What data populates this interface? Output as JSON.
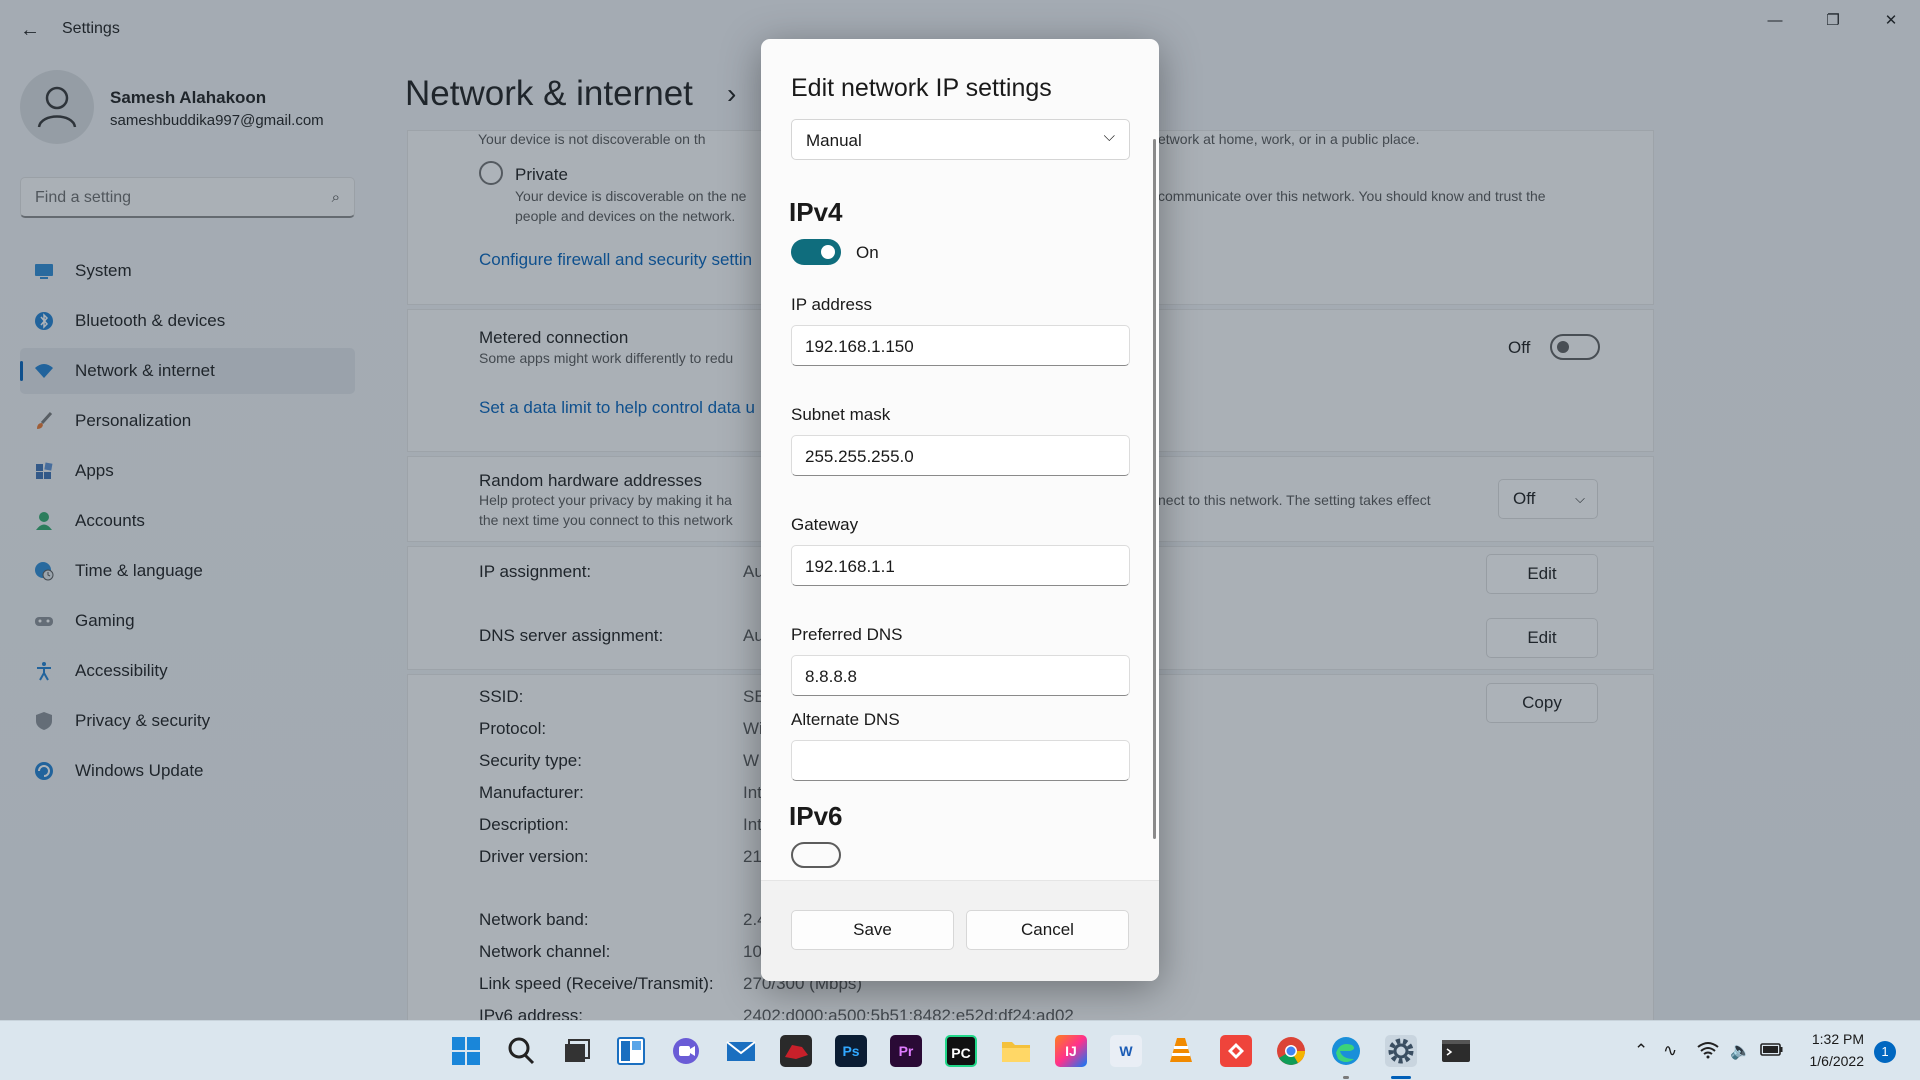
{
  "window": {
    "title": "Settings",
    "minimize": "—",
    "maximize": "❐",
    "close": "✕"
  },
  "profile": {
    "name": "Samesh Alahakoon",
    "email": "sameshbuddika997@gmail.com"
  },
  "search": {
    "placeholder": "Find a setting"
  },
  "sidebar": {
    "items": [
      {
        "label": "System",
        "icon": "system-icon"
      },
      {
        "label": "Bluetooth & devices",
        "icon": "bluetooth-icon"
      },
      {
        "label": "Network & internet",
        "icon": "wifi-icon",
        "active": true
      },
      {
        "label": "Personalization",
        "icon": "brush-icon"
      },
      {
        "label": "Apps",
        "icon": "apps-icon"
      },
      {
        "label": "Accounts",
        "icon": "accounts-icon"
      },
      {
        "label": "Time & language",
        "icon": "globe-clock-icon"
      },
      {
        "label": "Gaming",
        "icon": "gamepad-icon"
      },
      {
        "label": "Accessibility",
        "icon": "accessibility-icon"
      },
      {
        "label": "Privacy & security",
        "icon": "shield-icon"
      },
      {
        "label": "Windows Update",
        "icon": "update-icon"
      }
    ]
  },
  "page": {
    "title": "Network & internet",
    "sep": "›"
  },
  "network_profile": {
    "public_desc_left": "Your device is not discoverable on th",
    "public_desc_right": "etwork at home, work, or in a public place.",
    "private_label": "Private",
    "private_desc_left": "Your device is discoverable on the ne",
    "private_desc_right": "communicate over this network. You should know and trust the",
    "private_desc_line2": "people and devices on the network.",
    "firewall_link": "Configure firewall and security settin"
  },
  "metered": {
    "title": "Metered connection",
    "desc": "Some apps might work differently to redu",
    "toggle_label": "Off",
    "toggle_on": false,
    "data_limit_link": "Set a data limit to help control data u"
  },
  "random_hw": {
    "title": "Random hardware addresses",
    "desc_left": "Help protect your privacy by making it ha",
    "desc_right": "nect to this network. The setting takes effect",
    "desc_line2": "the next time you connect to this network",
    "value": "Off"
  },
  "assignments": {
    "ip_label": "IP assignment:",
    "ip_value": "Au",
    "dns_label": "DNS server assignment:",
    "dns_value": "Au",
    "edit_label": "Edit"
  },
  "properties": {
    "copy_label": "Copy",
    "rows": [
      {
        "label": "SSID:",
        "value": "SB"
      },
      {
        "label": "Protocol:",
        "value": "Wi"
      },
      {
        "label": "Security type:",
        "value": "W"
      },
      {
        "label": "Manufacturer:",
        "value": "Int"
      },
      {
        "label": "Description:",
        "value": "Int"
      },
      {
        "label": "Driver version:",
        "value": "21."
      },
      {
        "label": "Network band:",
        "value": "2.4"
      },
      {
        "label": "Network channel:",
        "value": "10"
      },
      {
        "label": "Link speed (Receive/Transmit):",
        "value": "270/300 (Mbps)"
      },
      {
        "label": "IPv6 address:",
        "value": "2402:d000:a500:5b51:8482:e52d:df24:ad02"
      }
    ]
  },
  "dialog": {
    "title": "Edit network IP settings",
    "mode": "Manual",
    "ipv4_heading": "IPv4",
    "ipv4_toggle_label": "On",
    "ipv4_on": true,
    "fields": {
      "ip_label": "IP address",
      "ip_value": "192.168.1.150",
      "subnet_label": "Subnet mask",
      "subnet_value": "255.255.255.0",
      "gateway_label": "Gateway",
      "gateway_value": "192.168.1.1",
      "pref_dns_label": "Preferred DNS",
      "pref_dns_value": "8.8.8.8",
      "alt_dns_label": "Alternate DNS",
      "alt_dns_value": ""
    },
    "ipv6_heading": "IPv6",
    "save_label": "Save",
    "cancel_label": "Cancel"
  },
  "taskbar": {
    "apps": [
      {
        "name": "start-button",
        "label": ""
      },
      {
        "name": "search-button",
        "label": ""
      },
      {
        "name": "task-view-button",
        "label": ""
      },
      {
        "name": "widgets-button",
        "label": ""
      },
      {
        "name": "chat-button",
        "label": ""
      },
      {
        "name": "mail-app",
        "label": ""
      },
      {
        "name": "game-app",
        "label": ""
      },
      {
        "name": "photoshop-app",
        "label": "Ps"
      },
      {
        "name": "premiere-app",
        "label": "Pr"
      },
      {
        "name": "pycharm-app",
        "label": "PC"
      },
      {
        "name": "file-explorer-app",
        "label": ""
      },
      {
        "name": "intellij-app",
        "label": "IJ"
      },
      {
        "name": "word-app",
        "label": "W"
      },
      {
        "name": "vlc-app",
        "label": ""
      },
      {
        "name": "anydesk-app",
        "label": ""
      },
      {
        "name": "chrome-app",
        "label": ""
      },
      {
        "name": "edge-app",
        "label": ""
      },
      {
        "name": "settings-app",
        "label": ""
      },
      {
        "name": "terminal-app",
        "label": ""
      }
    ],
    "clock_time": "1:32 PM",
    "clock_date": "1/6/2022",
    "notification_count": "1"
  }
}
